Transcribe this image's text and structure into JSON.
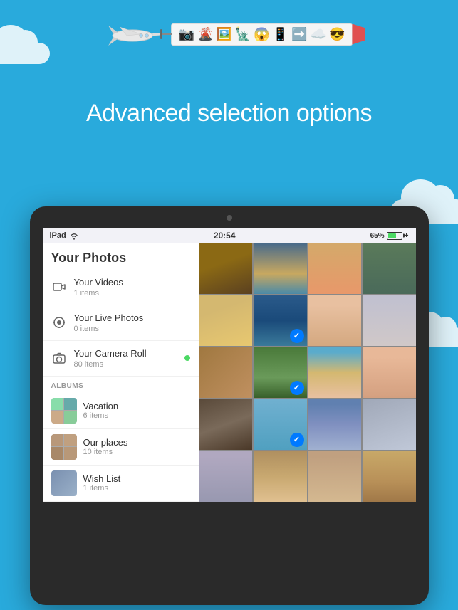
{
  "page": {
    "bg_color": "#29aadc",
    "heading": "Advanced selection options"
  },
  "airplane": {
    "banner_emojis": [
      "📷",
      "🌋",
      "🖼️",
      "🗽",
      "😱",
      "📱",
      "➡️",
      "☁️",
      "😎"
    ]
  },
  "ipad": {
    "status_bar": {
      "left": "iPad",
      "time": "20:54",
      "battery_pct": "65%",
      "wifi": true
    },
    "sidebar": {
      "your_photos_label": "Your Photos",
      "smart_albums": [
        {
          "icon": "video",
          "title": "Your Videos",
          "count": "1 items"
        },
        {
          "icon": "livephoto",
          "title": "Your Live Photos",
          "count": "0 items"
        },
        {
          "icon": "camera",
          "title": "Your Camera Roll",
          "count": "80 items",
          "dot": true
        }
      ],
      "albums_header": "ALBUMS",
      "albums": [
        {
          "name": "Vacation",
          "count": "6 items"
        },
        {
          "name": "Our places",
          "count": "10 items"
        },
        {
          "name": "Wish List",
          "count": "1 items"
        }
      ]
    },
    "photos": [
      {
        "id": 1,
        "color_class": "photo-dog"
      },
      {
        "id": 2,
        "color_class": "photo-beach",
        "checked": false
      },
      {
        "id": 3,
        "color_class": "photo-sandals"
      },
      {
        "id": 4,
        "color_class": "photo-people"
      },
      {
        "id": 5,
        "color_class": "photo-castle"
      },
      {
        "id": 6,
        "color_class": "photo-sand-text"
      },
      {
        "id": 7,
        "color_class": "photo-diver"
      },
      {
        "id": 8,
        "color_class": "photo-woman"
      },
      {
        "id": 9,
        "color_class": "photo-puzzle",
        "checked": true
      },
      {
        "id": 10,
        "color_class": "photo-cat"
      },
      {
        "id": 11,
        "color_class": "photo-frog",
        "checked": false
      },
      {
        "id": 12,
        "color_class": "photo-beach2"
      },
      {
        "id": 13,
        "color_class": "photo-girl"
      },
      {
        "id": 14,
        "color_class": "photo-goat"
      },
      {
        "id": 15,
        "color_class": "photo-dog2"
      },
      {
        "id": 16,
        "color_class": "photo-beach2",
        "checked": false
      },
      {
        "id": 17,
        "color_class": "photo-frog"
      },
      {
        "id": 18,
        "color_class": "photo-beach",
        "checked": true
      },
      {
        "id": 19,
        "color_class": "photo-eiffel"
      },
      {
        "id": 20,
        "color_class": "photo-colosseum"
      }
    ]
  }
}
